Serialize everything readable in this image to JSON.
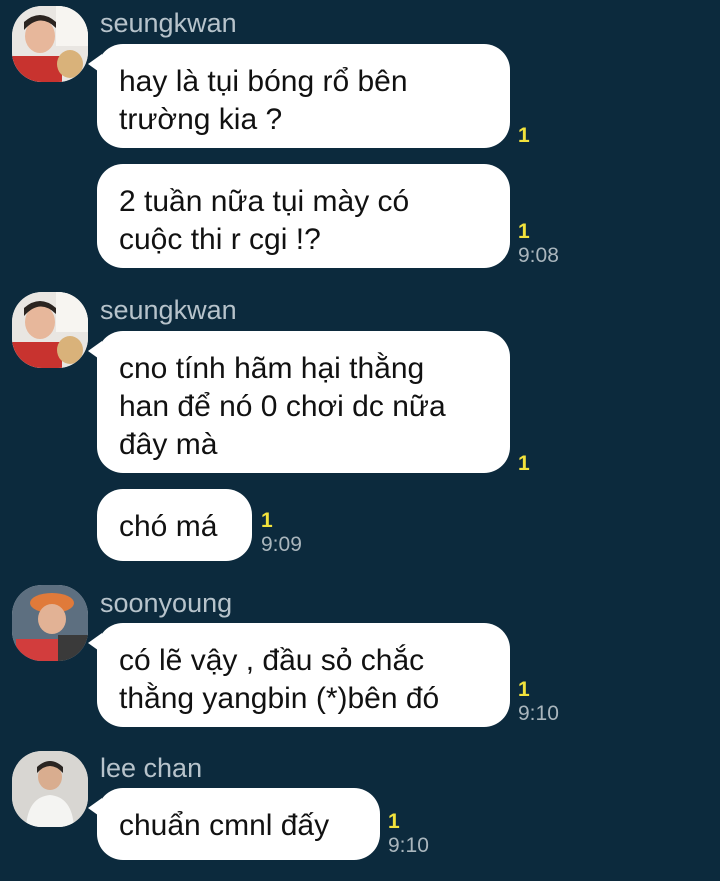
{
  "messages": [
    {
      "sender": "seungkwan",
      "text_lines": [
        "hay là tụi bóng rổ bên",
        "trường kia ?"
      ],
      "unread": "1",
      "time": ""
    },
    {
      "sender": "",
      "text_lines": [
        "2 tuần nữa tụi mày có",
        "cuộc thi r cgi !?"
      ],
      "unread": "1",
      "time": "9:08"
    },
    {
      "sender": "seungkwan",
      "text_lines": [
        "cno tính hãm hại thằng",
        "han để nó 0 chơi  dc nữa",
        "đây mà"
      ],
      "unread": "1",
      "time": ""
    },
    {
      "sender": "",
      "text_lines": [
        "chó má"
      ],
      "unread": "1",
      "time": "9:09"
    },
    {
      "sender": "soonyoung",
      "text_lines": [
        "có lẽ vậy , đầu sỏ chắc",
        "thằng yangbin (*)bên đó"
      ],
      "unread": "1",
      "time": "9:10"
    },
    {
      "sender": "lee chan",
      "text_lines": [
        "chuẩn cmnl đấy"
      ],
      "unread": "1",
      "time": "9:10"
    }
  ],
  "colors": {
    "background": "#0c2a3d",
    "bubble": "#ffffff",
    "unread": "#f2e23c",
    "sender": "#b7c3cb",
    "time": "#aab6bd"
  }
}
